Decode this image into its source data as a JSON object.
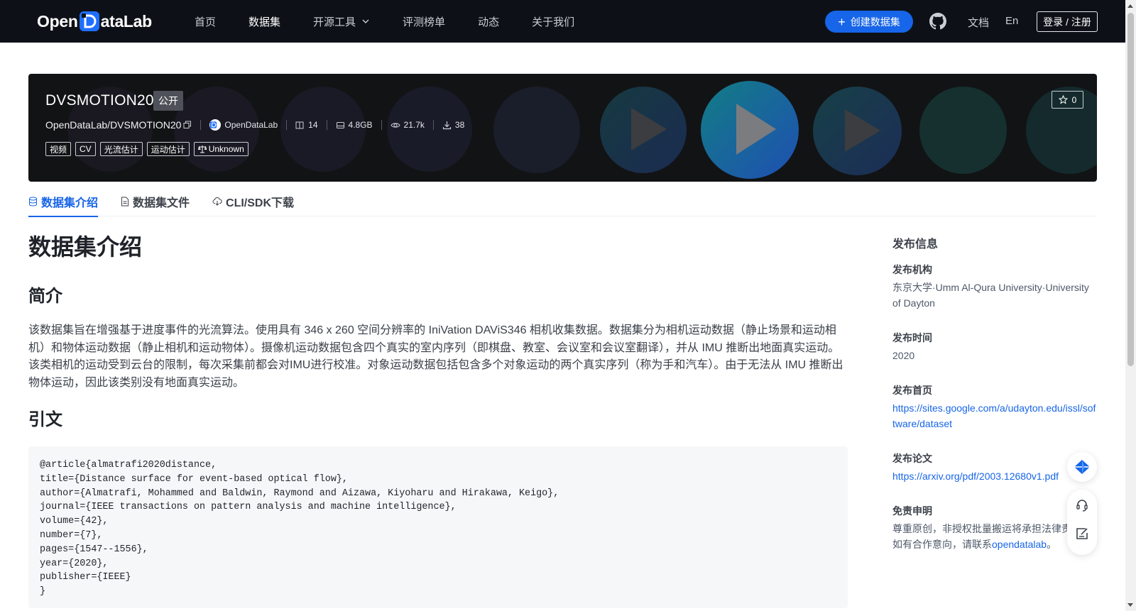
{
  "nav": {
    "logo": {
      "part1": "Open",
      "part2": "ataLab"
    },
    "links": [
      {
        "label": "首页"
      },
      {
        "label": "数据集"
      },
      {
        "label": "开源工具"
      },
      {
        "label": "评测榜单"
      },
      {
        "label": "动态"
      },
      {
        "label": "关于我们"
      }
    ],
    "create_label": "创建数据集",
    "docs_label": "文档",
    "lang_label": "En",
    "login_label": "登录 / 注册"
  },
  "dataset": {
    "title": "DVSMOTION20",
    "visibility": "公开",
    "path": "OpenDataLab/DVSMOTION20",
    "org": "OpenDataLab",
    "files": "14",
    "size": "4.8GB",
    "views": "21.7k",
    "downloads": "38",
    "tags": [
      "视频",
      "CV",
      "光流估计",
      "运动估计"
    ],
    "license": "Unknown",
    "stars": "0"
  },
  "tabs": [
    {
      "label": "数据集介绍"
    },
    {
      "label": "数据集文件"
    },
    {
      "label": "CLI/SDK下载"
    }
  ],
  "content": {
    "heading": "数据集介绍",
    "intro_heading": "简介",
    "intro_text": "该数据集旨在增强基于进度事件的光流算法。使用具有 346 x 260 空间分辨率的 IniVation DAViS346 相机收集数据。数据集分为相机运动数据（静止场景和运动相机）和物体运动数据（静止相机和运动物体）。摄像机运动数据包含四个真实的室内序列（即棋盘、教室、会议室和会议室翻译），并从 IMU 推断出地面真实运动。该类相机的运动受到云台的限制，每次采集前都会对IMU进行校准。对象运动数据包括包含多个对象运动的两个真实序列（称为手和汽车）。由于无法从 IMU 推断出物体运动，因此该类别没有地面真实运动。",
    "citation_heading": "引文",
    "citation": "@article{almatrafi2020distance,\ntitle={Distance surface for event-based optical flow},\nauthor={Almatrafi, Mohammed and Baldwin, Raymond and Aizawa, Kiyoharu and Hirakawa, Keigo},\njournal={IEEE transactions on pattern analysis and machine intelligence},\nvolume={42},\nnumber={7},\npages={1547--1556},\nyear={2020},\npublisher={IEEE}\n}"
  },
  "sidebar": {
    "title": "发布信息",
    "org_label": "发布机构",
    "org_value": "东京大学·Umm Al-Qura University·University of Dayton",
    "time_label": "发布时间",
    "time_value": "2020",
    "home_label": "发布首页",
    "home_url": "https://sites.google.com/a/udayton.edu/issl/software/dataset",
    "paper_label": "发布论文",
    "paper_url": "https://arxiv.org/pdf/2003.12680v1.pdf",
    "disclaimer_label": "免责申明",
    "disclaimer_line1": "尊重原创，非授权批量搬运将承担法律责任",
    "disclaimer_line2_prefix": "如有合作意向，请联系",
    "disclaimer_link": "opendatalab",
    "disclaimer_line2_suffix": "。"
  },
  "colors": {
    "accent": "#1765e8",
    "nav_bg": "#0d1117",
    "banner_bg": "#121315"
  }
}
